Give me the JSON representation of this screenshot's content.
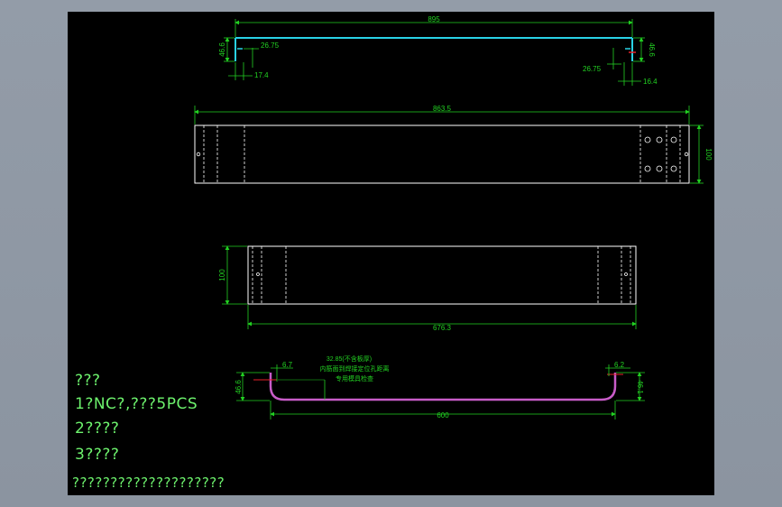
{
  "colors": {
    "background": "#000000",
    "frame": "#8e97a3",
    "dimension": "#22d122",
    "outline": "#ffffff",
    "bend_line": "#29d2e6",
    "sheet_profile": "#c85cc8",
    "centerline": "#e8202a",
    "note_text": "#6df26d"
  },
  "view_top": {
    "overall": "895",
    "left_height": "46.6",
    "right_height": "46.6",
    "left_offset": "26.75",
    "right_offset": "26.75",
    "left_flange": "17.4",
    "right_flange": "16.4"
  },
  "view_front": {
    "length": "863.5",
    "height": "100"
  },
  "view_back": {
    "length": "676.3",
    "height": "100"
  },
  "view_bottom": {
    "span": "600",
    "left_height": "46.6",
    "right_height": "46.1",
    "left_offset": "6.7",
    "right_offset": "6.2",
    "note_line1": "32.85(不含板厚)",
    "note_line2": "内筋面到焊接定位孔距离",
    "note_line3": "专用模具检查"
  },
  "notes": {
    "title": "???",
    "line1": "1?NC?,???5PCS",
    "line2": "2????",
    "line3": "3????",
    "footer": "????????????????????"
  }
}
